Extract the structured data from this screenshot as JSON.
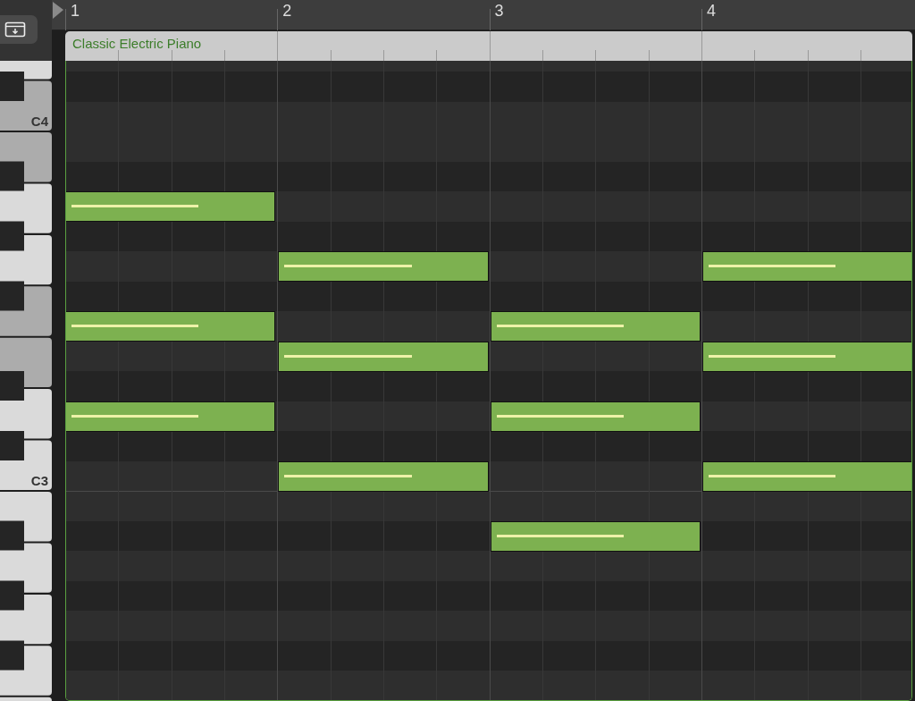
{
  "ruler": {
    "bars": [
      "1",
      "2",
      "3",
      "4"
    ]
  },
  "region": {
    "name": "Classic Electric Piano"
  },
  "keyboard": {
    "white_keys": [
      {
        "highlighted": false
      },
      {
        "label": "C4",
        "highlighted": true
      },
      {
        "highlighted": true
      },
      {
        "highlighted": false
      },
      {
        "highlighted": false
      },
      {
        "highlighted": true
      },
      {
        "highlighted": true
      },
      {
        "highlighted": false
      },
      {
        "label": "C3",
        "highlighted": false
      },
      {
        "highlighted": false
      },
      {
        "highlighted": false
      },
      {
        "highlighted": false
      },
      {
        "highlighted": false
      },
      {
        "highlighted": false
      }
    ]
  },
  "lanes": [
    {
      "kind": "natural",
      "cells": [
        {
          "on": false
        },
        {
          "on": false
        },
        {
          "on": false
        },
        {
          "on": false
        }
      ]
    },
    {
      "kind": "sharp",
      "cells": [
        {
          "on": false
        },
        {
          "on": false
        },
        {
          "on": false
        },
        {
          "on": false
        }
      ]
    },
    {
      "kind": "natural",
      "cells": [
        {
          "on": false
        },
        {
          "on": false
        },
        {
          "on": false
        },
        {
          "on": false
        }
      ]
    },
    {
      "kind": "natural",
      "cells": [
        {
          "on": false
        },
        {
          "on": false
        },
        {
          "on": false
        },
        {
          "on": false
        }
      ]
    },
    {
      "kind": "sharp",
      "cells": [
        {
          "on": false
        },
        {
          "on": false
        },
        {
          "on": false
        },
        {
          "on": false
        }
      ]
    },
    {
      "kind": "natural",
      "cells": [
        {
          "on": true
        },
        {
          "on": false
        },
        {
          "on": false
        },
        {
          "on": false
        }
      ]
    },
    {
      "kind": "sharp",
      "cells": [
        {
          "on": false
        },
        {
          "on": false
        },
        {
          "on": false
        },
        {
          "on": false
        }
      ]
    },
    {
      "kind": "natural",
      "cells": [
        {
          "on": false
        },
        {
          "on": true
        },
        {
          "on": false
        },
        {
          "on": true
        }
      ]
    },
    {
      "kind": "sharp",
      "cells": [
        {
          "on": false
        },
        {
          "on": false
        },
        {
          "on": false
        },
        {
          "on": false
        }
      ]
    },
    {
      "kind": "natural",
      "cells": [
        {
          "on": true
        },
        {
          "on": false
        },
        {
          "on": true
        },
        {
          "on": false
        }
      ]
    },
    {
      "kind": "natural",
      "cells": [
        {
          "on": false
        },
        {
          "on": true
        },
        {
          "on": false
        },
        {
          "on": true
        }
      ]
    },
    {
      "kind": "sharp",
      "cells": [
        {
          "on": false
        },
        {
          "on": false
        },
        {
          "on": false
        },
        {
          "on": false
        }
      ]
    },
    {
      "kind": "natural",
      "cells": [
        {
          "on": true
        },
        {
          "on": false
        },
        {
          "on": true
        },
        {
          "on": false
        }
      ]
    },
    {
      "kind": "sharp",
      "cells": [
        {
          "on": false
        },
        {
          "on": false
        },
        {
          "on": false
        },
        {
          "on": false
        }
      ]
    },
    {
      "kind": "natural",
      "cells": [
        {
          "on": false
        },
        {
          "on": true
        },
        {
          "on": false
        },
        {
          "on": true
        }
      ]
    },
    {
      "kind": "natural",
      "cells": [
        {
          "on": false
        },
        {
          "on": false
        },
        {
          "on": false
        },
        {
          "on": false
        }
      ]
    },
    {
      "kind": "sharp",
      "cells": [
        {
          "on": false
        },
        {
          "on": false
        },
        {
          "on": true
        },
        {
          "on": false
        }
      ]
    },
    {
      "kind": "natural",
      "cells": [
        {
          "on": false
        },
        {
          "on": false
        },
        {
          "on": false
        },
        {
          "on": false
        }
      ]
    },
    {
      "kind": "sharp",
      "cells": [
        {
          "on": false
        },
        {
          "on": false
        },
        {
          "on": false
        },
        {
          "on": false
        }
      ]
    },
    {
      "kind": "natural",
      "cells": [
        {
          "on": false
        },
        {
          "on": false
        },
        {
          "on": false
        },
        {
          "on": false
        }
      ]
    },
    {
      "kind": "sharp",
      "cells": [
        {
          "on": false
        },
        {
          "on": false
        },
        {
          "on": false
        },
        {
          "on": false
        }
      ]
    },
    {
      "kind": "natural",
      "cells": [
        {
          "on": false
        },
        {
          "on": false
        },
        {
          "on": false
        },
        {
          "on": false
        }
      ]
    }
  ]
}
